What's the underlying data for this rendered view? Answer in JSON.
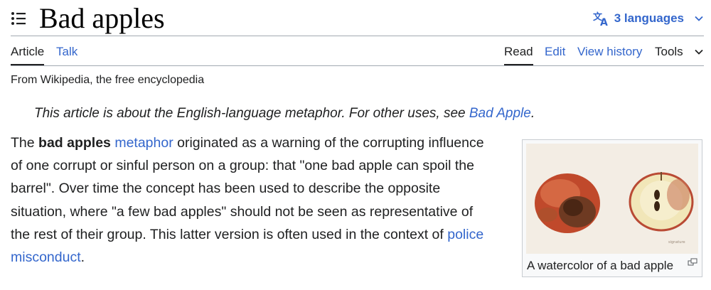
{
  "header": {
    "title": "Bad apples",
    "languages_label": "3 languages"
  },
  "tabs": {
    "article": "Article",
    "talk": "Talk",
    "read": "Read",
    "edit": "Edit",
    "history": "View history",
    "tools": "Tools"
  },
  "tagline": "From Wikipedia, the free encyclopedia",
  "hatnote": {
    "prefix": "This article is about the English-language metaphor. For other uses, see ",
    "link": "Bad Apple",
    "suffix": "."
  },
  "paragraph": {
    "l1_a": "The ",
    "l1_bold": "bad apples",
    "l1_b": " ",
    "l1_link": "metaphor",
    "l1_c": " originated as a warning of the corrupting influence",
    "l2": "of one corrupt or sinful person on a group: that \"one bad apple can spoil the",
    "l3": "barrel\". Over time the concept has been used to describe the opposite",
    "l4": "situation, where \"a few bad apples\" should not be seen as representative of",
    "l5_a": "the rest of their group. This latter version is often used in the context of ",
    "l5_link": "police",
    "l6_link": "misconduct",
    "l6_b": "."
  },
  "figure": {
    "caption": "A watercolor of a bad apple"
  },
  "colors": {
    "link": "#3366cc",
    "text": "#202122",
    "border": "#a2a9b1"
  },
  "icons": [
    "toc-icon",
    "language-icon",
    "chevron-down-icon",
    "enlarge-icon"
  ]
}
